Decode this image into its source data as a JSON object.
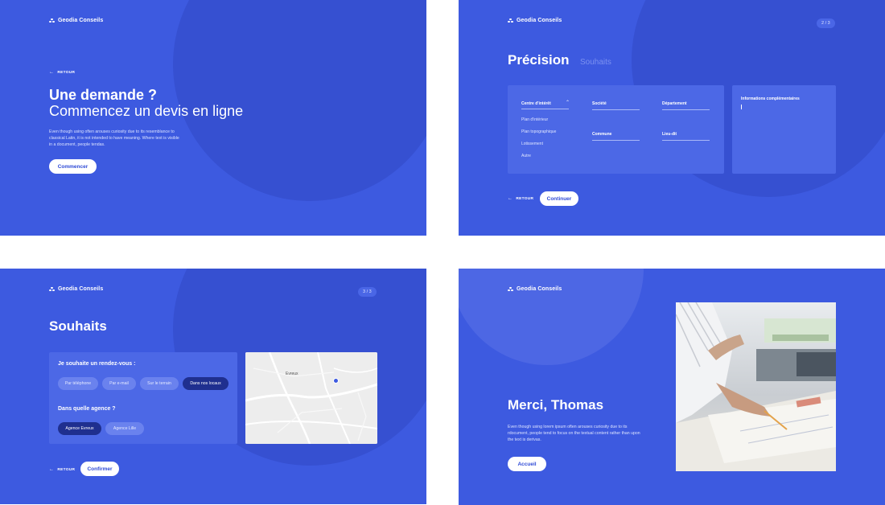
{
  "colors": {
    "panel_bg": "#3d5ae0",
    "circle": "#3650d1",
    "card": "#4c68e6",
    "chip": "#6a82ee",
    "chip_selected": "#1f2f8f",
    "button_text": "#2e4ad6"
  },
  "brand": {
    "name": "Geodia Conseils",
    "logo_icon": "three-dots-logo-icon"
  },
  "intro": {
    "back_label": "RETOUR",
    "title_bold": "Une demande ?",
    "title_light": "Commencez un devis en ligne",
    "description": "Even though using often arouses curiosity due to its resemblance to classical Latin, it is not intended to have meaning. Where text is visible in a document, people tendas.",
    "cta_label": "Commencer"
  },
  "precision": {
    "step": "2 / 3",
    "title": "Précision",
    "next_title": "Souhaits",
    "dropdown_label": "Centre d'intérêt",
    "dropdown_options": [
      "Plan d'intérieur",
      "Plan topographique",
      "Lotissement",
      "Autre"
    ],
    "fields": {
      "societe": "Société",
      "departement": "Département",
      "commune": "Commune",
      "lieu_dit": "Lieu-dit"
    },
    "info_label": "Informations complémentaires",
    "back_label": "RETOUR",
    "continue_label": "Continuer"
  },
  "souhaits": {
    "step": "3 / 3",
    "title": "Souhaits",
    "rdv_question": "Je souhaite un rendez-vous :",
    "rdv_options": [
      "Par téléphone",
      "Par e-mail",
      "Sur le terrain",
      "Dans nos locaux"
    ],
    "rdv_selected": "Dans nos locaux",
    "agency_question": "Dans quelle agence ?",
    "agency_options": [
      "Agence Evreux",
      "Agence Lille"
    ],
    "agency_selected": "Agence Evreux",
    "map_city": "Evreux",
    "back_label": "RETOUR",
    "confirm_label": "Confirmer"
  },
  "merci": {
    "title": "Merci, Thomas",
    "description": "Even though using lorem ipsum often arouses curiosity due to its rdocument, people tend to focus on the textual content rather than upon the text is derivas.",
    "home_label": "Accueil"
  }
}
